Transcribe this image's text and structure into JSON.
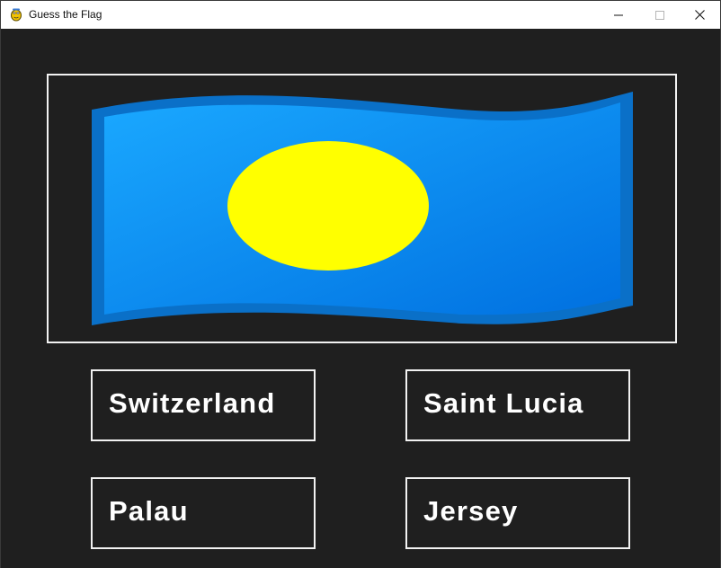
{
  "window": {
    "title": "Guess the Flag",
    "app_icon": "pygame-snake-icon",
    "controls": {
      "minimize_icon": "minimize-icon",
      "maximize_icon": "maximize-icon",
      "close_icon": "close-icon"
    }
  },
  "flag": {
    "icon": "palau-flag",
    "colors": {
      "field_light": "#1aa8ff",
      "field_dark": "#0070e0",
      "disc": "#ffff00"
    }
  },
  "answers": [
    {
      "label": "Switzerland"
    },
    {
      "label": "Saint Lucia"
    },
    {
      "label": "Palau"
    },
    {
      "label": "Jersey"
    }
  ],
  "colors": {
    "background": "#1f1f1f",
    "border": "#f2f2f2",
    "text": "#ffffff"
  }
}
